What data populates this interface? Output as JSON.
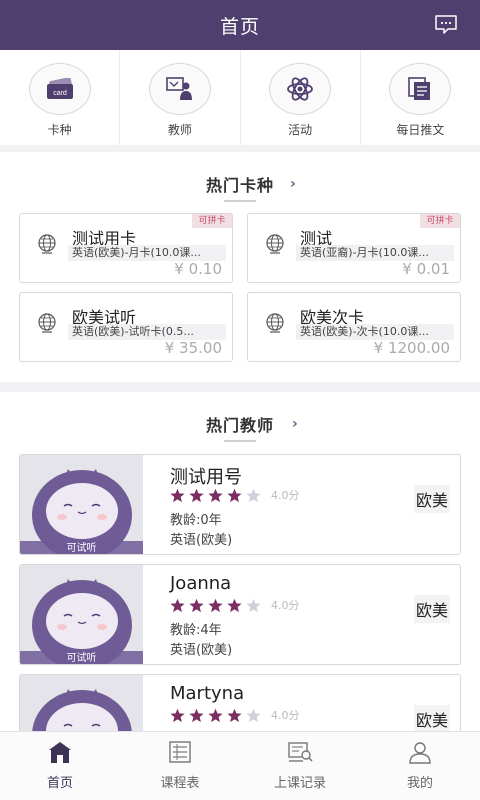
{
  "header": {
    "title": "首页"
  },
  "quicknav": [
    {
      "label": "卡种",
      "icon": "card-icon",
      "icon_text": "card"
    },
    {
      "label": "教师",
      "icon": "teacher-icon"
    },
    {
      "label": "活动",
      "icon": "atom-icon"
    },
    {
      "label": "每日推文",
      "icon": "articles-icon"
    }
  ],
  "hot_cards": {
    "title": "热门卡种",
    "arrow": "›",
    "items": [
      {
        "name": "测试用卡",
        "desc": "英语(欧美)-月卡(10.0课...",
        "price": "¥ 0.10",
        "tag": "可拼卡"
      },
      {
        "name": "测试",
        "desc": "英语(亚裔)-月卡(10.0课...",
        "price": "¥ 0.01",
        "tag": "可拼卡"
      },
      {
        "name": "欧美试听",
        "desc": "英语(欧美)-试听卡(0.5...",
        "price": "¥ 35.00",
        "tag": ""
      },
      {
        "name": "欧美次卡",
        "desc": "英语(欧美)-次卡(10.0课...",
        "price": "¥ 1200.00",
        "tag": ""
      }
    ]
  },
  "hot_teachers": {
    "title": "热门教师",
    "arrow": "›",
    "items": [
      {
        "name": "测试用号",
        "rating": 4,
        "score": "4.0分",
        "age": "教龄:0年",
        "lang": "英语(欧美)",
        "region": "欧美",
        "trial": "可试听"
      },
      {
        "name": "Joanna",
        "rating": 4,
        "score": "4.0分",
        "age": "教龄:4年",
        "lang": "英语(欧美)",
        "region": "欧美",
        "trial": "可试听"
      },
      {
        "name": "Martyna",
        "rating": 4,
        "score": "4.0分",
        "age": "",
        "lang": "",
        "region": "欧美",
        "trial": ""
      }
    ]
  },
  "tabbar": [
    {
      "label": "首页",
      "icon": "home-icon",
      "active": true
    },
    {
      "label": "课程表",
      "icon": "schedule-icon",
      "active": false
    },
    {
      "label": "上课记录",
      "icon": "record-icon",
      "active": false
    },
    {
      "label": "我的",
      "icon": "profile-icon",
      "active": false
    }
  ],
  "colors": {
    "brand": "#4f3f6e",
    "star_on": "#7a2f63",
    "star_off": "#cfd0dc",
    "tag_bg": "#f2dfe4"
  }
}
